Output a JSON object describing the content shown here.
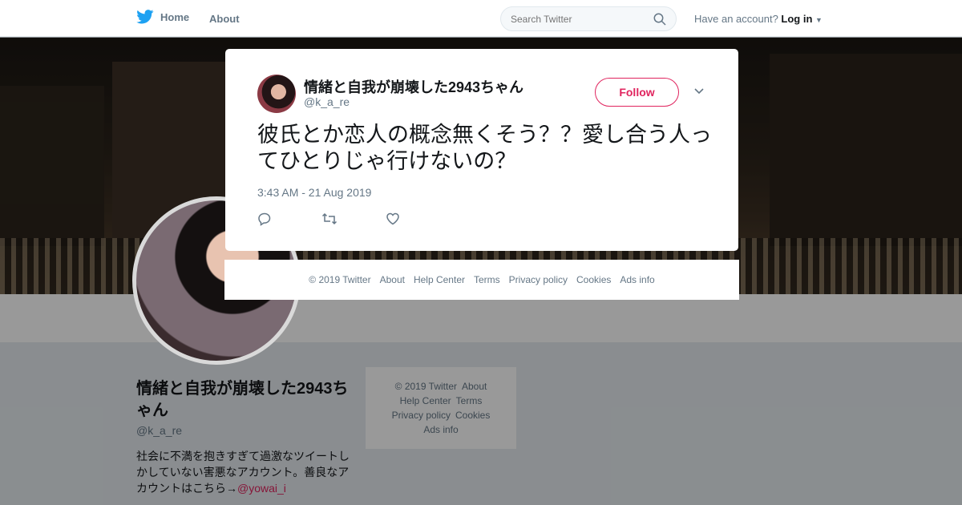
{
  "nav": {
    "home_label": "Home",
    "about_label": "About",
    "search_placeholder": "Search Twitter",
    "have_account": "Have an account?",
    "login_label": "Log in"
  },
  "profile": {
    "display_name": "情緒と自我が崩壊した2943ちゃん",
    "handle": "@k_a_re",
    "bio": "社会に不満を抱きすぎて過激なツイートしかしていない害悪なアカウント。善良なアカウントはこちら→",
    "bio_link": "@yowai_i"
  },
  "sidebar_footer": {
    "copyright": "© 2019 Twitter",
    "about": "About",
    "help": "Help Center",
    "terms": "Terms",
    "privacy": "Privacy policy",
    "cookies": "Cookies",
    "ads": "Ads info"
  },
  "tweet": {
    "author_name": "情緒と自我が崩壊した2943ちゃん",
    "author_handle": "@k_a_re",
    "follow_label": "Follow",
    "text": "彼氏とか恋人の概念無くそう？？愛し合う人ってひとりじゃ行けないの？",
    "timestamp": "3:43 AM - 21 Aug 2019"
  },
  "modal_footer": {
    "copyright": "© 2019 Twitter",
    "about": "About",
    "help": "Help Center",
    "terms": "Terms",
    "privacy": "Privacy policy",
    "cookies": "Cookies",
    "ads": "Ads info"
  },
  "colors": {
    "brand": "#1da1f2",
    "accent": "#e0245e",
    "muted": "#657786"
  }
}
